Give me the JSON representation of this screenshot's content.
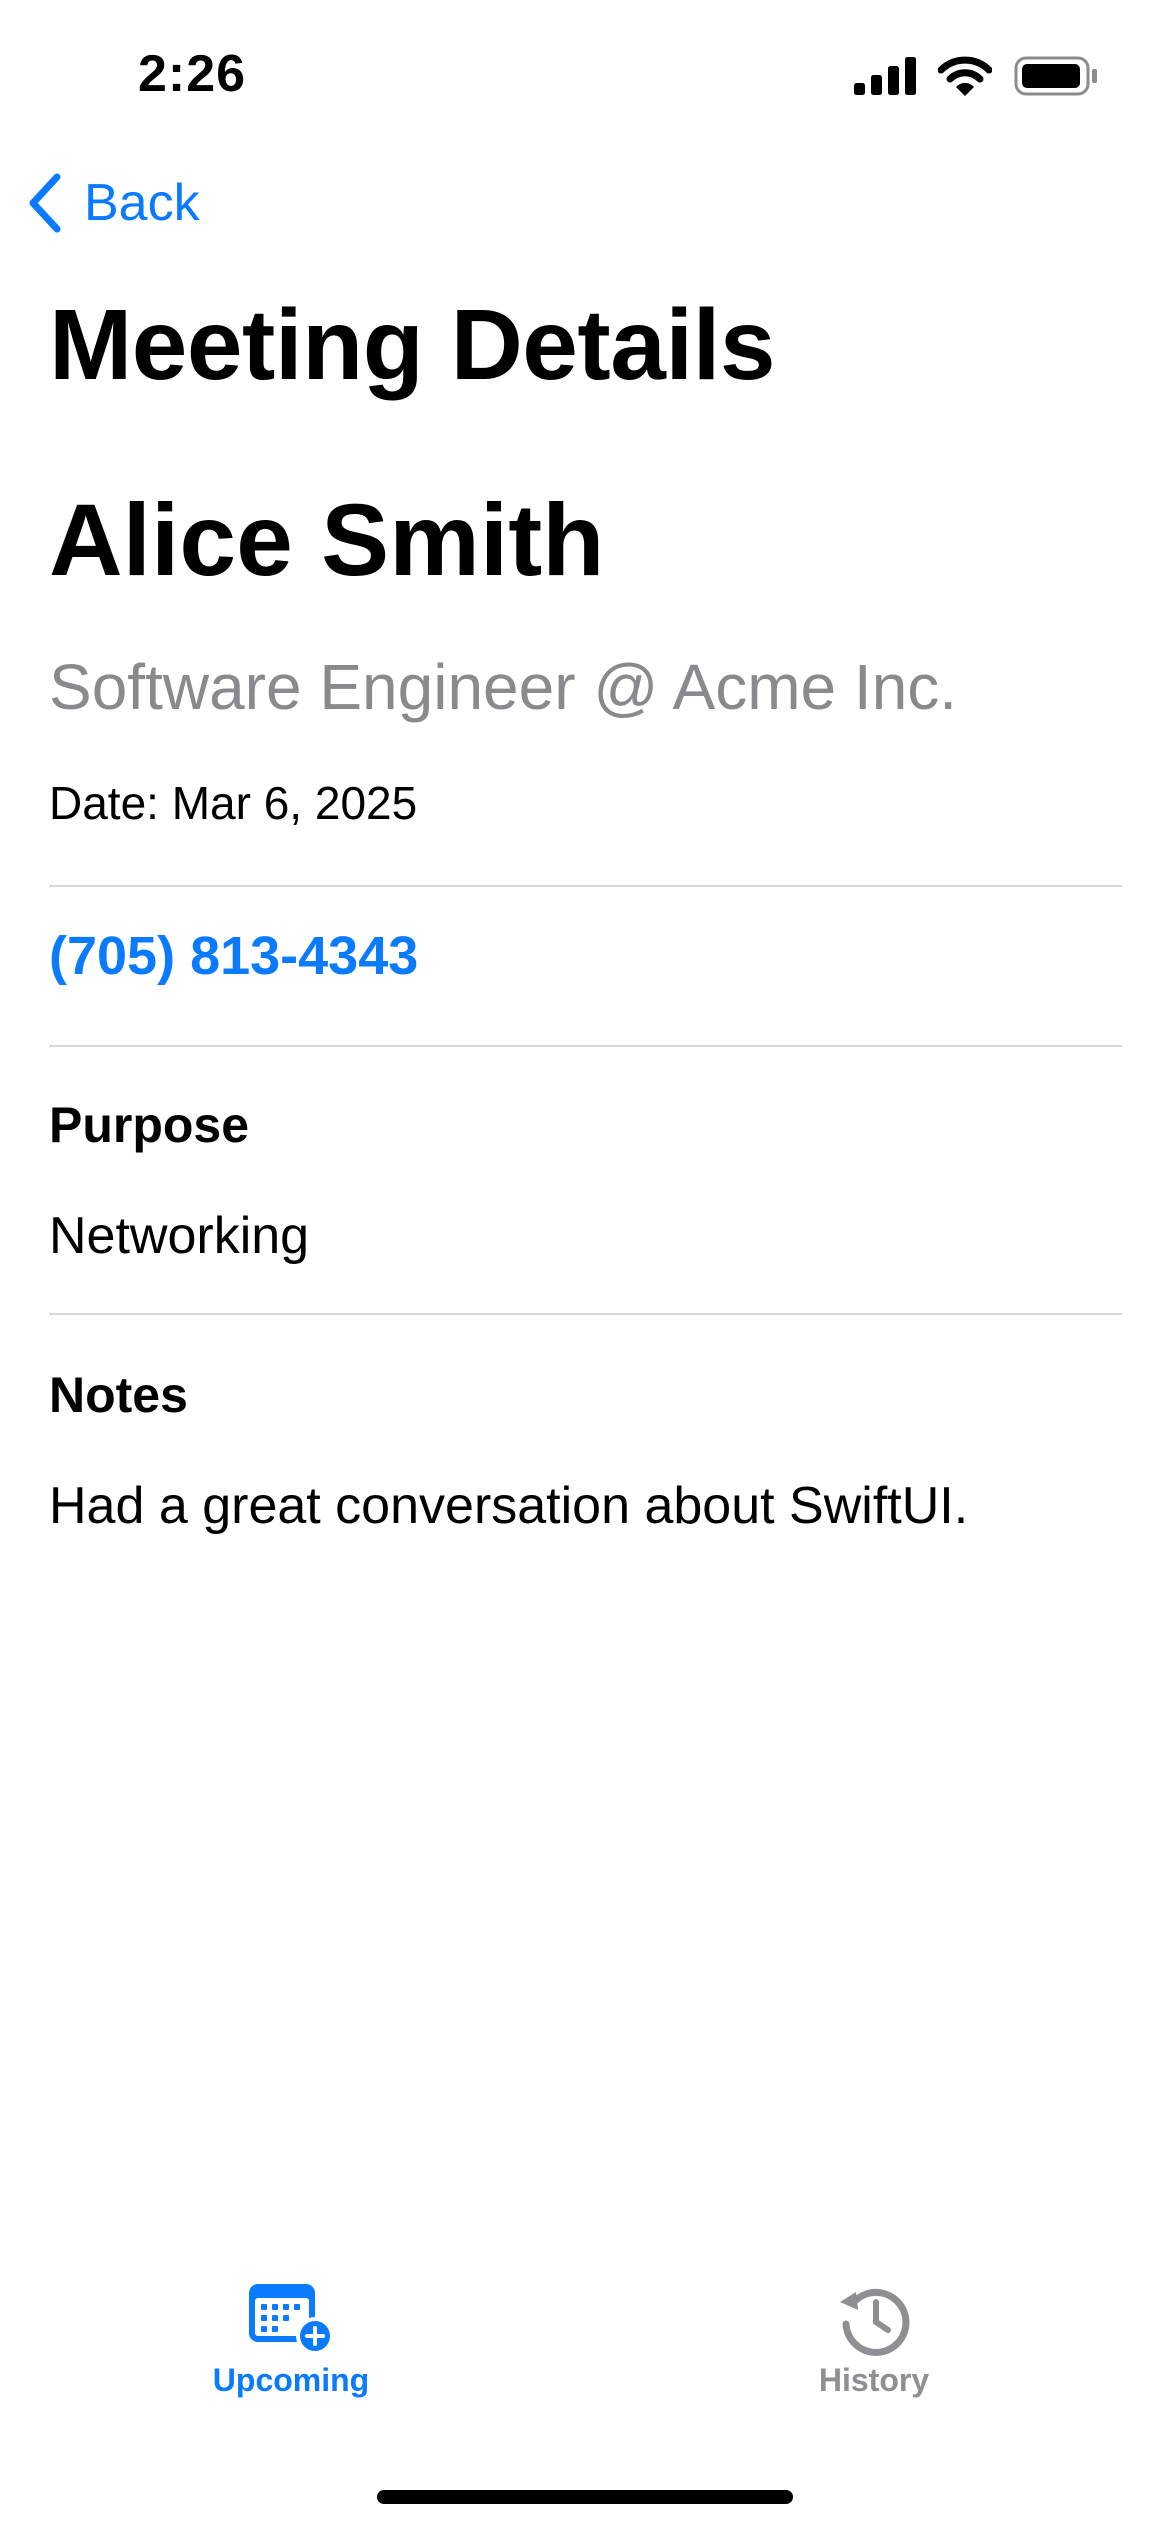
{
  "status_bar": {
    "time": "2:26"
  },
  "navigation": {
    "back_label": "Back"
  },
  "page": {
    "title": "Meeting Details"
  },
  "contact": {
    "name": "Alice Smith",
    "subtitle": "Software Engineer @ Acme Inc.",
    "date": "Date: Mar 6, 2025",
    "phone": "(705) 813-4343"
  },
  "purpose": {
    "label": "Purpose",
    "value": "Networking"
  },
  "notes": {
    "label": "Notes",
    "value": "Had a great conversation about SwiftUI."
  },
  "tab_bar": {
    "tabs": [
      {
        "label": "Upcoming",
        "icon": "calendar-badge-plus-icon",
        "selected": true
      },
      {
        "label": "History",
        "icon": "clock-history-icon",
        "selected": false
      }
    ]
  },
  "colors": {
    "accent": "#0A7AFF",
    "secondary_text": "#8A8A8E",
    "inactive_tab": "#8E8E93",
    "divider": "#D8D8DC"
  }
}
